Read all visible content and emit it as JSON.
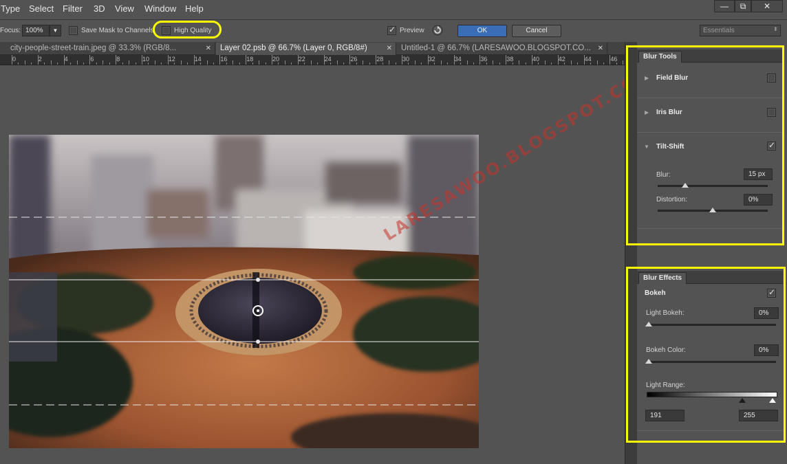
{
  "menu": [
    "Type",
    "Select",
    "Filter",
    "3D",
    "View",
    "Window",
    "Help"
  ],
  "window_controls": {
    "minimize": "—",
    "restore": "⧉",
    "close": "✕"
  },
  "options": {
    "focus_label": "Focus:",
    "focus_value": "100%",
    "save_mask_label": "Save Mask to Channels",
    "high_quality_label": "High Quality",
    "preview_label": "Preview",
    "ok_label": "OK",
    "cancel_label": "Cancel",
    "workspace_label": "Essentials"
  },
  "tabs": [
    {
      "label": "city-people-street-train.jpeg @ 33.3% (RGB/8..."
    },
    {
      "label": "Layer 02.psb @ 66.7% (Layer 0, RGB/8#)"
    },
    {
      "label": "Untitled-1 @ 66.7% (LARESAWOO.BLOGSPOT.CO..."
    }
  ],
  "ruler_labels": [
    "0",
    "2",
    "4",
    "6",
    "8",
    "10",
    "12",
    "14",
    "16",
    "18",
    "20",
    "22",
    "24",
    "26",
    "28",
    "30",
    "32",
    "34",
    "36",
    "38",
    "40",
    "42",
    "44",
    "46"
  ],
  "watermark": "LARESAWOO.BLOGSPOT.CO.ID",
  "blur_tools": {
    "tab_label": "Blur Tools",
    "field_blur": {
      "label": "Field Blur",
      "checked": false
    },
    "iris_blur": {
      "label": "Iris Blur",
      "checked": false
    },
    "tilt_shift": {
      "label": "Tilt-Shift",
      "checked": true
    },
    "blur_label": "Blur:",
    "blur_value": "15 px",
    "blur_level": 0.25,
    "distortion_label": "Distortion:",
    "distortion_value": "0%",
    "distortion_level": 0.5
  },
  "blur_effects": {
    "tab_label": "Blur Effects",
    "bokeh_label": "Bokeh",
    "bokeh_checked": true,
    "light_bokeh_label": "Light Bokeh:",
    "light_bokeh_value": "0%",
    "bokeh_color_label": "Bokeh Color:",
    "bokeh_color_value": "0%",
    "light_range_label": "Light Range:",
    "light_range_low": "191",
    "light_range_high": "255"
  },
  "colors": {
    "highlight": "#ffff00",
    "ok_button": "#3a6db5",
    "ground": "#9b5330",
    "pool": "#2a2433"
  }
}
